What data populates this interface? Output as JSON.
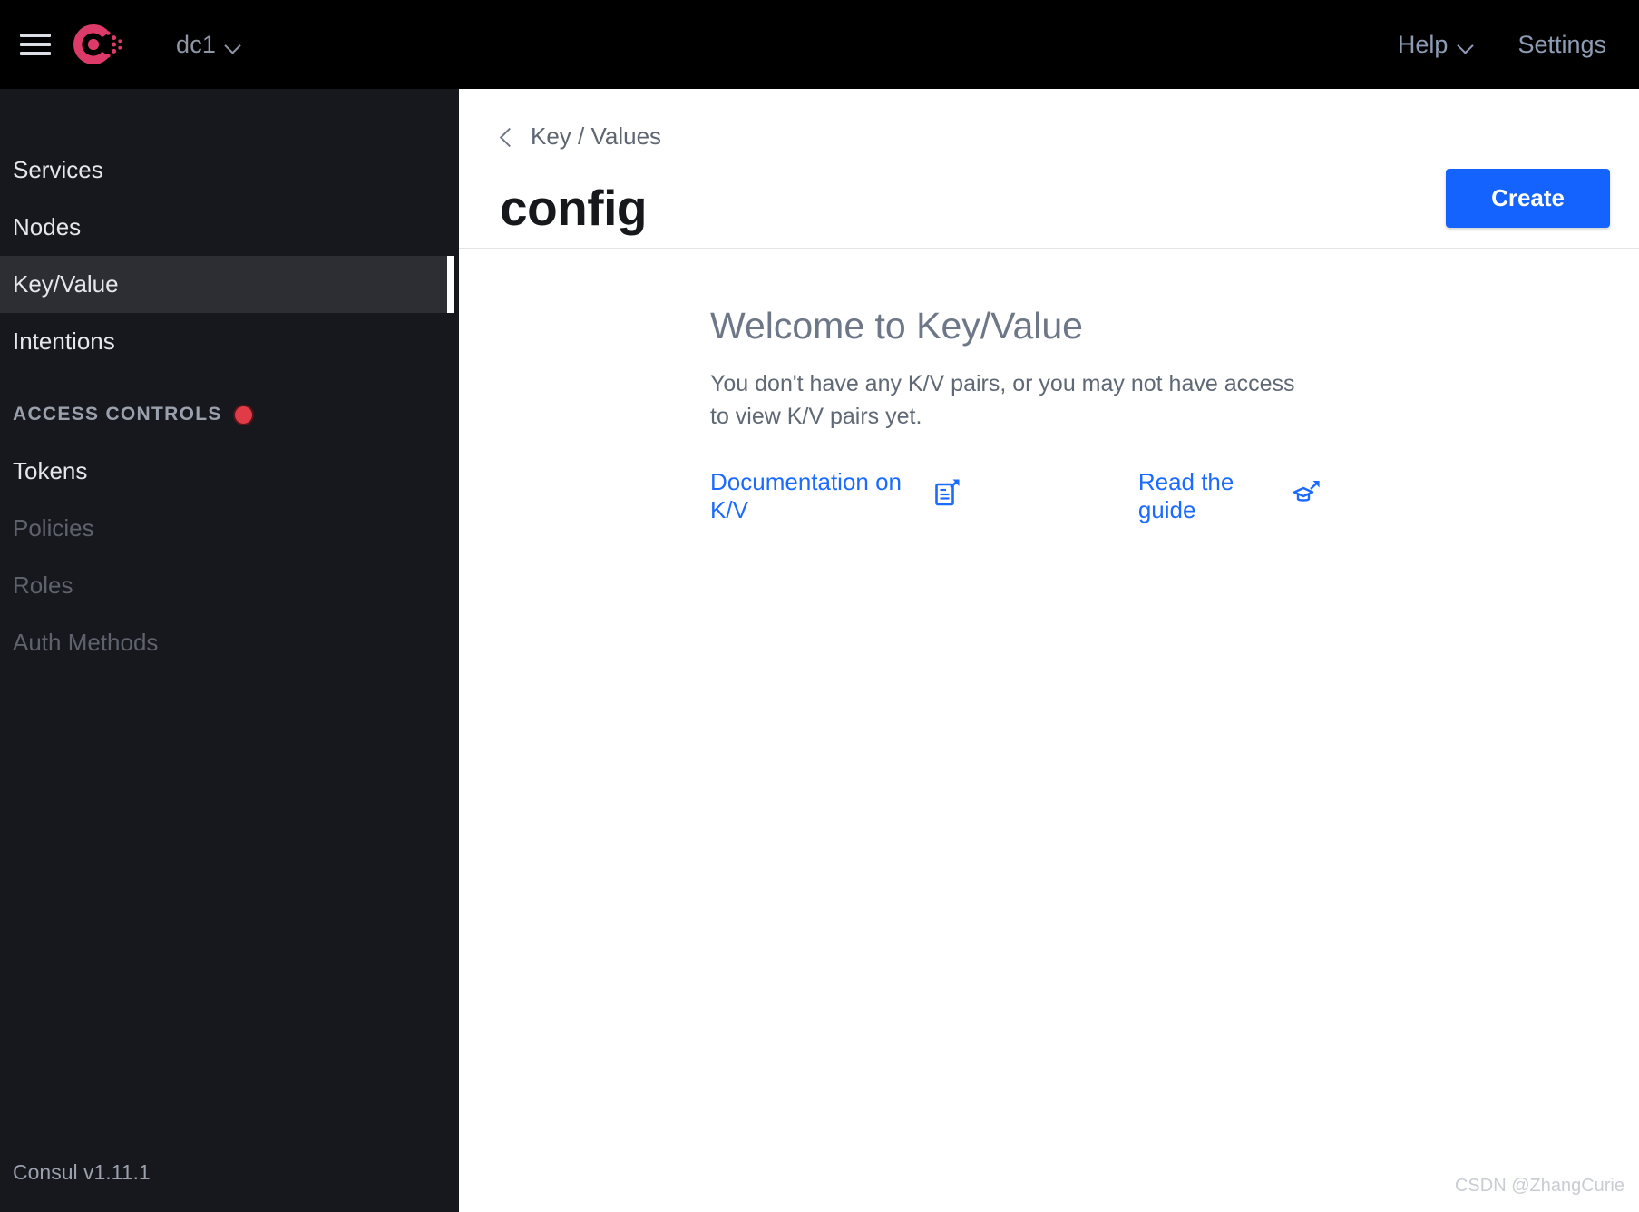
{
  "header": {
    "menu_icon": "hamburger-menu-icon",
    "logo_icon": "consul-logo-icon",
    "datacenter": "dc1",
    "datacenter_chevron": "chevron-down-icon",
    "help_label": "Help",
    "help_chevron": "chevron-down-icon",
    "settings_label": "Settings",
    "background": "#000000"
  },
  "sidebar": {
    "background": "#17181d",
    "active_background": "#2c2e34",
    "items": [
      {
        "label": "Services",
        "state": "normal"
      },
      {
        "label": "Nodes",
        "state": "normal"
      },
      {
        "label": "Key/Value",
        "state": "active"
      },
      {
        "label": "Intentions",
        "state": "normal"
      }
    ],
    "group": {
      "label": "ACCESS CONTROLS",
      "badge_icon": "red-dot-icon",
      "badge_color": "#e03c47",
      "items": [
        {
          "label": "Tokens",
          "state": "normal"
        },
        {
          "label": "Policies",
          "state": "disabled"
        },
        {
          "label": "Roles",
          "state": "disabled"
        },
        {
          "label": "Auth Methods",
          "state": "disabled"
        }
      ]
    },
    "version": "Consul v1.11.1"
  },
  "main": {
    "breadcrumb": {
      "back_icon": "chevron-left-icon",
      "label": "Key / Values"
    },
    "page_title": "config",
    "create_button": {
      "label": "Create",
      "color": "#1563ff"
    },
    "empty_state": {
      "title": "Welcome to Key/Value",
      "description": "You don't have any K/V pairs, or you may not have access to view K/V pairs yet.",
      "links": [
        {
          "label": "Documentation on K/V",
          "icon": "document-external-link-icon"
        },
        {
          "label": "Read the guide",
          "icon": "graduation-cap-external-link-icon"
        }
      ],
      "link_color": "#1c6bff"
    }
  },
  "watermark": "CSDN @ZhangCurie"
}
